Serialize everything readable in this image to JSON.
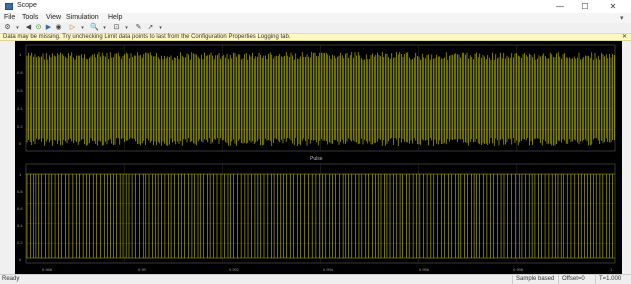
{
  "window": {
    "title": "Scope",
    "minimize": "—",
    "maximize": "☐",
    "close": "✕"
  },
  "menu": [
    "File",
    "Tools",
    "View",
    "Simulation",
    "Help"
  ],
  "toolbar": {
    "settings_icon": "⚙",
    "rewind_icon": "◀",
    "run_icon": "⊙",
    "step_icon": "▶",
    "stop_icon": "◉",
    "highlight_icon": "▷",
    "zoom_icon": "🔍",
    "fit_icon": "⊡",
    "cursor_icon": "✎",
    "pin_icon": "➚"
  },
  "infobar": {
    "message": "Data may be missing.  Try unchecking Limit data points to last from the Configuration Properties Logging tab.",
    "close": "✕"
  },
  "plot_top": {
    "title": "",
    "yticks": [
      "1",
      "0.8",
      "0.6",
      "0.4",
      "0.2",
      "0"
    ]
  },
  "plot_bottom": {
    "title": "Pulse",
    "yticks": [
      "1",
      "0.8",
      "0.6",
      "0.4",
      "0.2",
      "0"
    ],
    "xticks": [
      "0.988",
      "0.99",
      "0.992",
      "0.994",
      "0.996",
      "0.998",
      "1"
    ]
  },
  "colors": {
    "trace": "#e6e600",
    "background": "#000000",
    "axes": "#5a5a5a"
  },
  "status": {
    "ready": "Ready",
    "mode": "Sample based",
    "offset": "Offset=0",
    "time": "T=1.000"
  }
}
